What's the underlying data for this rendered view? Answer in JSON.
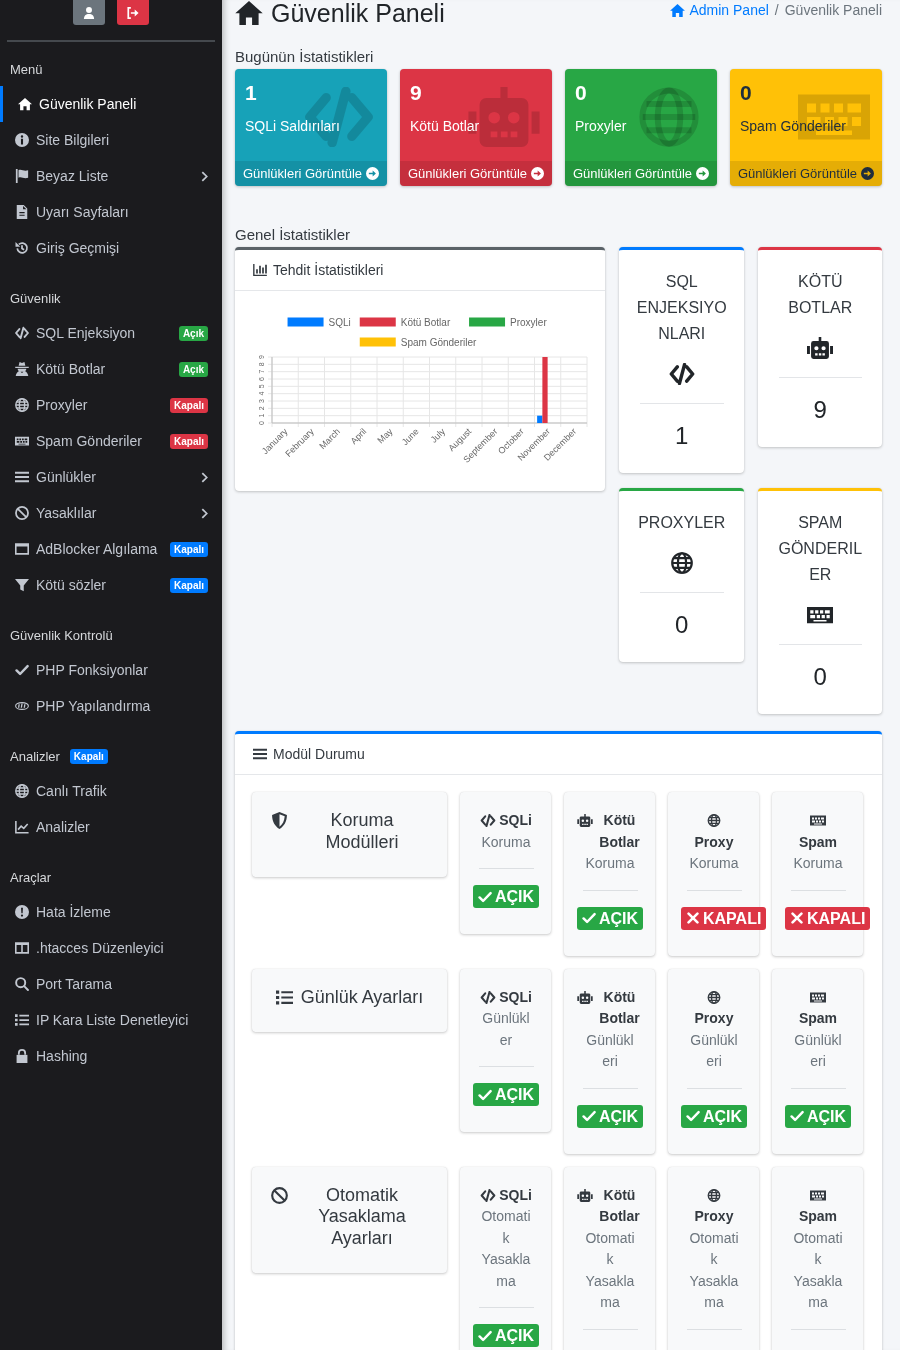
{
  "sidebar": {
    "sections": [
      {
        "heading": "Menü",
        "items": [
          {
            "label": "Güvenlik Paneli",
            "selected": true,
            "submenu": false
          },
          {
            "label": "Site Bilgileri",
            "selected": false,
            "submenu": false
          },
          {
            "label": "Beyaz Liste",
            "selected": false,
            "submenu": true
          },
          {
            "label": "Uyarı Sayfaları",
            "selected": false,
            "submenu": false
          },
          {
            "label": "Giriş Geçmişi",
            "selected": false,
            "submenu": false
          }
        ]
      },
      {
        "heading": "Güvenlik",
        "items": [
          {
            "label": "SQL Enjeksiyon",
            "selected": false,
            "submenu": false,
            "badge": {
              "text": "Açık",
              "color": "#28a745"
            }
          },
          {
            "label": "Kötü Botlar",
            "selected": false,
            "submenu": false,
            "badge": {
              "text": "Açık",
              "color": "#28a745"
            }
          },
          {
            "label": "Proxyler",
            "selected": false,
            "submenu": false,
            "badge": {
              "text": "Kapalı",
              "color": "#dc3545"
            }
          },
          {
            "label": "Spam Gönderiler",
            "selected": false,
            "submenu": false,
            "badge": {
              "text": "Kapalı",
              "color": "#dc3545"
            }
          },
          {
            "label": "Günlükler",
            "selected": false,
            "submenu": true
          },
          {
            "label": "Yasaklılar",
            "selected": false,
            "submenu": true
          },
          {
            "label": "AdBlocker Algılama",
            "selected": false,
            "submenu": false,
            "badge": {
              "text": "Kapalı",
              "color": "#007bff"
            }
          },
          {
            "label": "Kötü sözler",
            "selected": false,
            "submenu": false,
            "badge": {
              "text": "Kapalı",
              "color": "#007bff"
            }
          }
        ]
      },
      {
        "heading": "Güvenlik Kontrolü",
        "items": [
          {
            "label": "PHP Fonksiyonlar",
            "selected": false,
            "submenu": false
          },
          {
            "label": "PHP Yapılandırma",
            "selected": false,
            "submenu": false
          }
        ]
      },
      {
        "heading": "Analizler",
        "heading_badge": {
          "text": "Kapalı",
          "color": "#007bff"
        },
        "items": [
          {
            "label": "Canlı Trafik",
            "selected": false,
            "submenu": false
          },
          {
            "label": "Analizler",
            "selected": false,
            "submenu": false
          }
        ]
      },
      {
        "heading": "Araçlar",
        "items": [
          {
            "label": "Hata İzleme",
            "selected": false,
            "submenu": false
          },
          {
            "label": ".htacces Düzenleyici",
            "selected": false,
            "submenu": false
          },
          {
            "label": "Port Tarama",
            "selected": false,
            "submenu": false
          },
          {
            "label": "IP Kara Liste Denetleyici",
            "selected": false,
            "submenu": false
          },
          {
            "label": "Hashing",
            "selected": false,
            "submenu": false
          }
        ]
      }
    ]
  },
  "header": {
    "title": "Güvenlik Paneli",
    "breadcrumb": {
      "separator": "/",
      "items": [
        {
          "label": "Admin Panel",
          "kind": "link"
        },
        {
          "label": "Güvenlik Paneli",
          "kind": "current"
        }
      ]
    }
  },
  "today": {
    "heading": "Bugünün İstatistikleri",
    "boxes": [
      {
        "value": "1",
        "label": "SQLi Saldırıları",
        "link": "Günlükleri Görüntüle",
        "color": "#17a2b8"
      },
      {
        "value": "9",
        "label": "Kötü Botlar",
        "link": "Günlükleri Görüntüle",
        "color": "#dc3545"
      },
      {
        "value": "0",
        "label": "Proxyler",
        "link": "Günlükleri Görüntüle",
        "color": "#28a745"
      },
      {
        "value": "0",
        "label": "Spam Gönderiler",
        "link": "Günlükleri Görüntüle",
        "color": "#ffc107"
      }
    ]
  },
  "general": {
    "heading": "Genel İstatistikler",
    "chart_card": {
      "title": "Tehdit İstatistikleri",
      "chart_data": {
        "type": "bar",
        "legend": "top",
        "grid": true,
        "categories": [
          "January",
          "February",
          "March",
          "April",
          "May",
          "June",
          "July",
          "August",
          "September",
          "October",
          "November",
          "December"
        ],
        "series": [
          {
            "name": "SQLi",
            "color": "#007bff",
            "values": [
              0,
              0,
              0,
              0,
              0,
              0,
              0,
              0,
              0,
              0,
              1,
              0
            ]
          },
          {
            "name": "Kötü Botlar",
            "color": "#dc3545",
            "values": [
              0,
              0,
              0,
              0,
              0,
              0,
              0,
              0,
              0,
              0,
              9,
              0
            ]
          },
          {
            "name": "Proxyler",
            "color": "#28a745",
            "values": [
              0,
              0,
              0,
              0,
              0,
              0,
              0,
              0,
              0,
              0,
              0,
              0
            ]
          },
          {
            "name": "Spam Gönderiler",
            "color": "#ffc107",
            "values": [
              0,
              0,
              0,
              0,
              0,
              0,
              0,
              0,
              0,
              0,
              0,
              0
            ]
          }
        ],
        "ylim": [
          0,
          9
        ],
        "yticks": [
          0,
          1,
          2,
          3,
          4,
          5,
          6,
          7,
          8,
          9
        ]
      }
    },
    "stat_cards": [
      {
        "title": "SQL ENJEKSIYONLARI",
        "value": "1",
        "color": "#007bff"
      },
      {
        "title": "KÖTÜ BOTLAR",
        "value": "9",
        "color": "#dc3545"
      },
      {
        "title": "PROXYLER",
        "value": "0",
        "color": "#28a745"
      },
      {
        "title": "SPAM GÖNDERILER",
        "value": "0",
        "color": "#ffc107"
      }
    ]
  },
  "modules": {
    "title": "Modül Durumu",
    "rows": [
      {
        "label": "Koruma Modülleri",
        "modules": [
          {
            "name": "SQLi",
            "sub": "Koruma",
            "status": "AÇIK",
            "on": true
          },
          {
            "name": "Kötü Botlar",
            "sub": "Koruma",
            "status": "AÇIK",
            "on": true
          },
          {
            "name": "Proxy",
            "sub": "Koruma",
            "status": "KAPALI",
            "on": false
          },
          {
            "name": "Spam",
            "sub": "Koruma",
            "status": "KAPALI",
            "on": false
          }
        ]
      },
      {
        "label": "Günlük Ayarları",
        "modules": [
          {
            "name": "SQLi",
            "sub": "Günlükler",
            "status": "AÇIK",
            "on": true
          },
          {
            "name": "Kötü Botlar",
            "sub": "Günlükleri",
            "status": "AÇIK",
            "on": true
          },
          {
            "name": "Proxy",
            "sub": "Günlükleri",
            "status": "AÇIK",
            "on": true
          },
          {
            "name": "Spam",
            "sub": "Günlükleri",
            "status": "AÇIK",
            "on": true
          }
        ]
      },
      {
        "label": "Otomatik Yasaklama Ayarları",
        "modules": [
          {
            "name": "SQLi",
            "sub": "Otomatik Yasaklama",
            "status": "AÇIK",
            "on": true
          },
          {
            "name": "Kötü Botlar",
            "sub": "Otomatik Yasaklama"
          },
          {
            "name": "Proxy",
            "sub": "Otomatik Yasaklama"
          },
          {
            "name": "Spam",
            "sub": "Otomatik Yasaklama"
          }
        ]
      }
    ]
  }
}
